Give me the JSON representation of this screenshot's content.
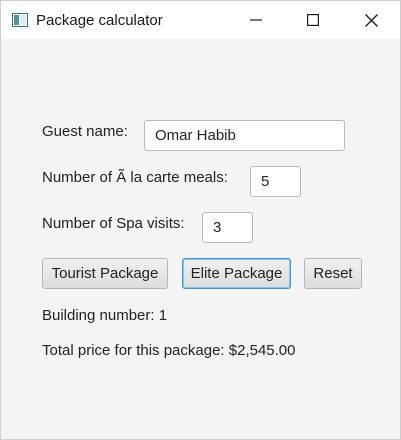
{
  "window": {
    "title": "Package calculator"
  },
  "form": {
    "guest_name_label": "Guest name:",
    "guest_name_value": "Omar Habib",
    "meals_label": "Number of Ã  la carte meals:",
    "meals_value": "5",
    "spa_label": "Number of Spa visits:",
    "spa_value": "3"
  },
  "buttons": {
    "tourist": "Tourist Package",
    "elite": "Elite Package",
    "reset": "Reset"
  },
  "output": {
    "building": "Building number: 1",
    "total": "Total price for this package: $2,545.00"
  },
  "colors": {
    "focus_border": "#3a9ad9",
    "window_bg": "#f4f4f4"
  }
}
